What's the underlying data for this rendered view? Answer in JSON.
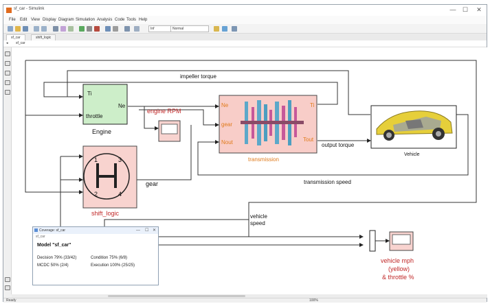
{
  "window": {
    "title": "sf_car - Simulink",
    "minimize": "—",
    "maximize": "☐",
    "close": "✕"
  },
  "menu": [
    "File",
    "Edit",
    "View",
    "Display",
    "Diagram",
    "Simulation",
    "Analysis",
    "Code",
    "Tools",
    "Help"
  ],
  "toolbar": {
    "stop_time": "Inf",
    "sim_mode": "Normal"
  },
  "tabs": [
    "sf_car",
    "shift_logic"
  ],
  "address": "sf_car",
  "blocks": {
    "engine": {
      "label": "Engine",
      "in1": "Ti",
      "in2": "throttle",
      "out": "Ne"
    },
    "transmission": {
      "label": "transmission",
      "in1": "Ne",
      "in2": "gear",
      "in3": "Nout",
      "out1": "Ti",
      "out2": "Tout"
    },
    "vehicle": {
      "label": "Vehicle"
    },
    "shift_logic": {
      "label": "shift_logic",
      "g1": "1",
      "g2": "2",
      "g3": "3",
      "g4": "4"
    },
    "engine_rpm": {
      "label": "engine RPM"
    },
    "vehicle_mph": {
      "line1": "vehicle mph",
      "line2": "(yellow)",
      "line3": "& throttle %"
    }
  },
  "signals": {
    "impeller_torque": "impeller torque",
    "output_torque": "output torque",
    "transmission_speed": "transmission speed",
    "gear": "gear",
    "vehicle_speed_1": "vehicle",
    "vehicle_speed_2": "speed"
  },
  "coverage_dialog": {
    "title": "Coverage: sf_car",
    "subtitle": "sf_car",
    "model": "Model \"sf_car\"",
    "decision": "Decision 79% (33/42)",
    "condition": "Condition 75% (6/8)",
    "mcdc": "MCDC 50% (2/4)",
    "execution": "Execution 100% (25/25)"
  },
  "status": {
    "left": "Ready",
    "zoom": "100%"
  },
  "colors": {
    "engine_fill": "#cdeec9",
    "transmission_fill": "#f8cdc8",
    "shift_fill": "#f8d3cf",
    "accent_red": "#c02626",
    "port_orange": "#e07a1a"
  }
}
